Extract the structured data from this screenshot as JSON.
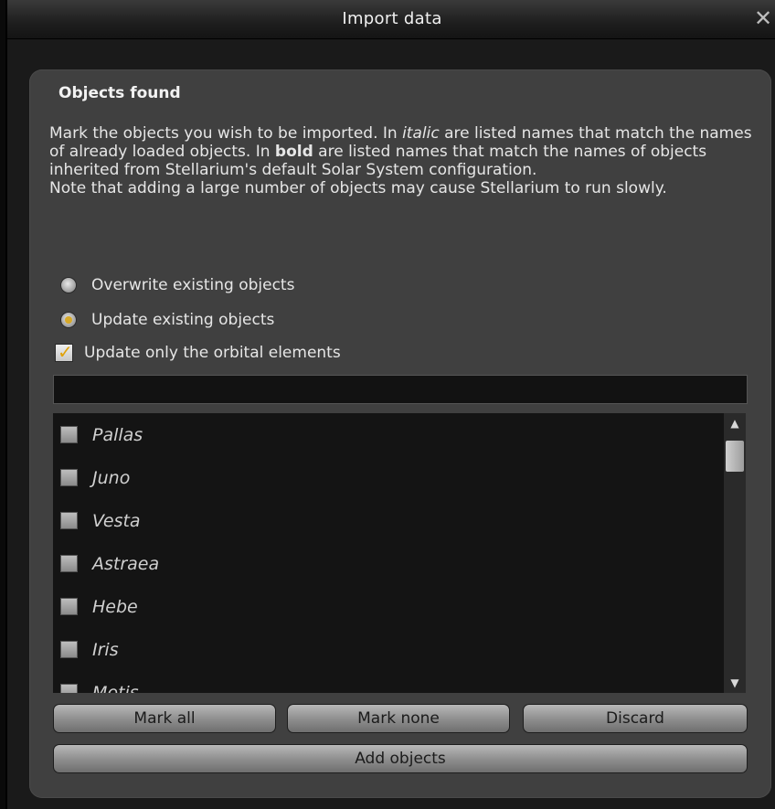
{
  "window": {
    "title": "Import data",
    "close_symbol": "✕"
  },
  "panel": {
    "heading": "Objects found",
    "description": {
      "part1": "Mark the objects you wish to be imported. In ",
      "italic_word": "italic",
      "part2": " are listed names that match the names of already loaded objects. In ",
      "bold_word": "bold",
      "part3": " are listed names that match the names of objects inherited from Stellarium's default Solar System configuration.",
      "note": "Note that adding a large number of objects may cause Stellarium to run slowly."
    },
    "options": {
      "overwrite_label": "Overwrite existing objects",
      "overwrite_selected": false,
      "update_label": "Update existing objects",
      "update_selected": true,
      "orbital_label": "Update only the orbital elements",
      "orbital_checked": true
    },
    "filter_value": "",
    "objects": [
      {
        "name": "Pallas",
        "checked": false
      },
      {
        "name": "Juno",
        "checked": false
      },
      {
        "name": "Vesta",
        "checked": false
      },
      {
        "name": "Astraea",
        "checked": false
      },
      {
        "name": "Hebe",
        "checked": false
      },
      {
        "name": "Iris",
        "checked": false
      },
      {
        "name": "Metis",
        "checked": false
      }
    ],
    "buttons": {
      "mark_all": "Mark all",
      "mark_none": "Mark none",
      "discard": "Discard",
      "add_objects": "Add objects"
    }
  },
  "colors": {
    "accent": "#d7a928",
    "panel_bg": "#404040",
    "list_bg": "#141414"
  }
}
